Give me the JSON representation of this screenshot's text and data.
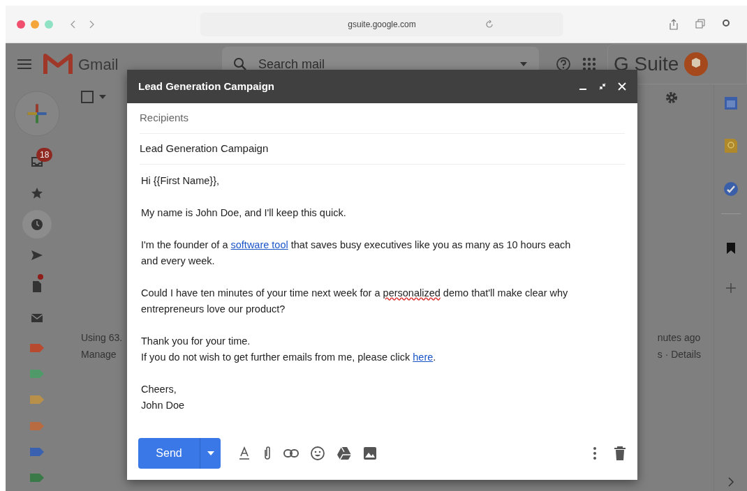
{
  "browser": {
    "url": "gsuite.google.com"
  },
  "gmail": {
    "logo_text": "Gmail",
    "search": {
      "placeholder": "Search mail"
    },
    "brand": "G Suite",
    "nav": [
      {
        "kind": "inbox",
        "badge": "18",
        "selected": false,
        "dot": false
      },
      {
        "kind": "star",
        "selected": false,
        "dot": false
      },
      {
        "kind": "clock",
        "selected": true,
        "dot": false
      },
      {
        "kind": "send",
        "selected": false,
        "dot": false
      },
      {
        "kind": "draft",
        "selected": false,
        "dot": true
      },
      {
        "kind": "mail",
        "selected": false,
        "dot": false
      }
    ],
    "labels": [
      {
        "color": "#b84a30"
      },
      {
        "color": "#4f9a68"
      },
      {
        "color": "#b8904a"
      },
      {
        "color": "#b86a40"
      },
      {
        "color": "#3a60b0"
      },
      {
        "color": "#3a7a48"
      }
    ],
    "storage": [
      "Using 63.",
      "Manage"
    ],
    "activity": [
      "nutes ago",
      "s · Details"
    ]
  },
  "compose": {
    "title": "Lead Generation Campaign",
    "recipients": {
      "placeholder": "Recipients"
    },
    "subject": {
      "value": "Lead Generation Campaign"
    },
    "paragraphs": [
      [
        [
          {
            "text": "Hi {{First Name}},"
          }
        ]
      ],
      [
        [
          {
            "text": "My name is John Doe, and I'll keep this quick."
          }
        ]
      ],
      [
        [
          {
            "text": "I'm the founder of a "
          },
          {
            "text": "software tool",
            "kind": "link"
          },
          {
            "text": " that saves busy executives like you as many as 10 hours each"
          }
        ],
        [
          {
            "text": "and every week."
          }
        ]
      ],
      [
        [
          {
            "text": "Could I have ten minutes of your time next week for a "
          },
          {
            "text": "personalized",
            "kind": "misspelled"
          },
          {
            "text": " demo that'll make clear why"
          }
        ],
        [
          {
            "text": "entrepreneurs love our product?"
          }
        ]
      ],
      [
        [
          {
            "text": "Thank you for your time."
          }
        ],
        [
          {
            "text": "If you do not wish to get further emails from me, please click "
          },
          {
            "text": "here",
            "kind": "link"
          },
          {
            "text": "."
          }
        ]
      ],
      [
        [
          {
            "text": "Cheers,"
          }
        ],
        [
          {
            "text": "John Doe"
          }
        ]
      ]
    ],
    "send_label": "Send"
  }
}
